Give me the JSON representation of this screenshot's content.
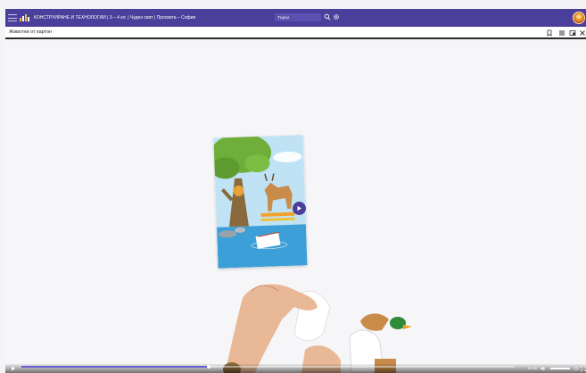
{
  "header": {
    "brand": "",
    "breadcrumb": "КОНСТРУИРАНЕ И ТЕХНОЛОГИИ | 3 – 4 кл. | Чуден свят | Просвета – София",
    "search_placeholder": "Търси",
    "icons": [
      "menu-icon",
      "brand-logo",
      "search-icon",
      "gear-icon",
      "avatar"
    ],
    "colors": {
      "bar": "#4a3f9a",
      "accent": "#f0c23a"
    }
  },
  "page": {
    "title": "Животни от картон",
    "icons": [
      "bookmark-icon",
      "list-icon",
      "window-icon",
      "close-icon"
    ]
  },
  "video": {
    "progress": 0.38,
    "time": "01:56",
    "volume": 0.9
  }
}
